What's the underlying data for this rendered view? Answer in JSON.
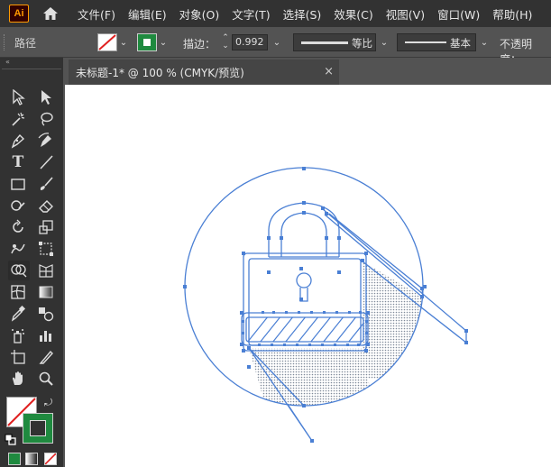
{
  "app": {
    "logo_text": "Ai"
  },
  "menu": [
    "文件(F)",
    "编辑(E)",
    "对象(O)",
    "文字(T)",
    "选择(S)",
    "效果(C)",
    "视图(V)",
    "窗口(W)",
    "帮助(H)"
  ],
  "control_bar": {
    "selection_label": "路径",
    "stroke_label": "描边：",
    "stroke_weight": "0.992",
    "width_profile": "等比",
    "brush_definition": "基本",
    "opacity_label": "不透明度："
  },
  "document": {
    "tab_title": "未标题-1* @ 100 % (CMYK/预览)",
    "close_glyph": "×"
  },
  "colors": {
    "path_blue": "#4a7fd4",
    "stroke_green": "#1f8a3f",
    "ui_dark": "#323232",
    "ui_mid": "#535353"
  },
  "tools": [
    "selection",
    "direct-selection",
    "magic-wand",
    "lasso",
    "pen",
    "curvature",
    "type",
    "line-segment",
    "rectangle",
    "paintbrush",
    "shaper",
    "eraser",
    "rotate",
    "scale",
    "warp",
    "free-transform",
    "shape-builder",
    "perspective-grid",
    "mesh",
    "gradient",
    "eyedropper",
    "blend",
    "symbol-sprayer",
    "column-graph",
    "artboard",
    "slice",
    "hand",
    "zoom"
  ]
}
